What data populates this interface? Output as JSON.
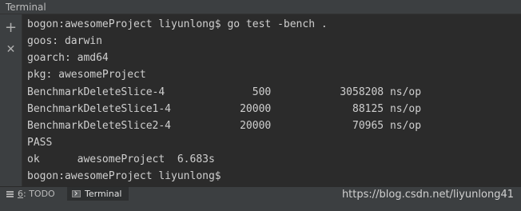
{
  "window": {
    "title": "Terminal"
  },
  "sidebar": {
    "add_icon": "plus-icon",
    "close_icon": "close-icon",
    "add_glyph": "+",
    "close_glyph": "✕"
  },
  "terminal": {
    "lines": [
      "bogon:awesomeProject liyunlong$ go test -bench .",
      "goos: darwin",
      "goarch: amd64",
      "pkg: awesomeProject",
      "BenchmarkDeleteSlice-4              500           3058208 ns/op",
      "BenchmarkDeleteSlice1-4           20000             88125 ns/op",
      "BenchmarkDeleteSlice2-4           20000             70965 ns/op",
      "PASS",
      "ok      awesomeProject  6.683s",
      "bogon:awesomeProject liyunlong$"
    ]
  },
  "toolwindow_bar": {
    "todo": {
      "shortcut": "6",
      "label": ": TODO",
      "icon": "todo-list-icon"
    },
    "terminal": {
      "label": "Terminal",
      "icon": "terminal-icon"
    }
  },
  "watermark": "https://blog.csdn.net/liyunlong41",
  "colors": {
    "background": "#2b2b2b",
    "panel": "#3c3f41",
    "text": "#cfcfcf"
  }
}
